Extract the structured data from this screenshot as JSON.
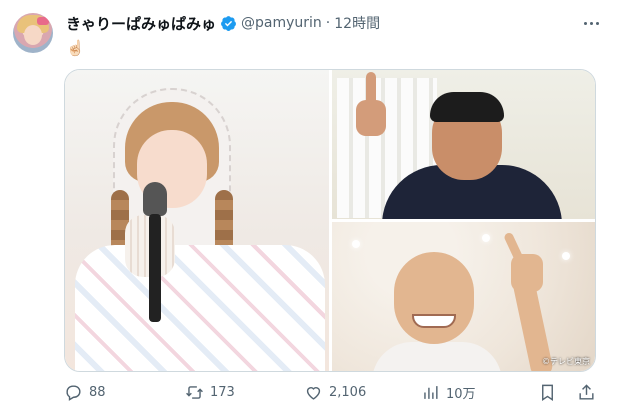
{
  "tweet": {
    "display_name": "きゃりーぱみゅぱみゅ",
    "handle": "@pamyurin",
    "separator": "·",
    "time": "12時間",
    "text": "☝🏻"
  },
  "media": {
    "watermark": "©テレビ東京"
  },
  "actions": {
    "replies": "88",
    "retweets": "173",
    "likes": "2,106",
    "views": "10万"
  },
  "icons": {
    "verified": "verified-badge-icon",
    "more": "more-options-icon",
    "reply": "reply-icon",
    "retweet": "retweet-icon",
    "like": "heart-icon",
    "views": "views-chart-icon",
    "bookmark": "bookmark-icon",
    "share": "share-icon"
  },
  "colors": {
    "verified_blue": "#1d9bf0",
    "secondary_text": "#536471",
    "primary_text": "#0f1419",
    "border": "#cfd9de"
  }
}
